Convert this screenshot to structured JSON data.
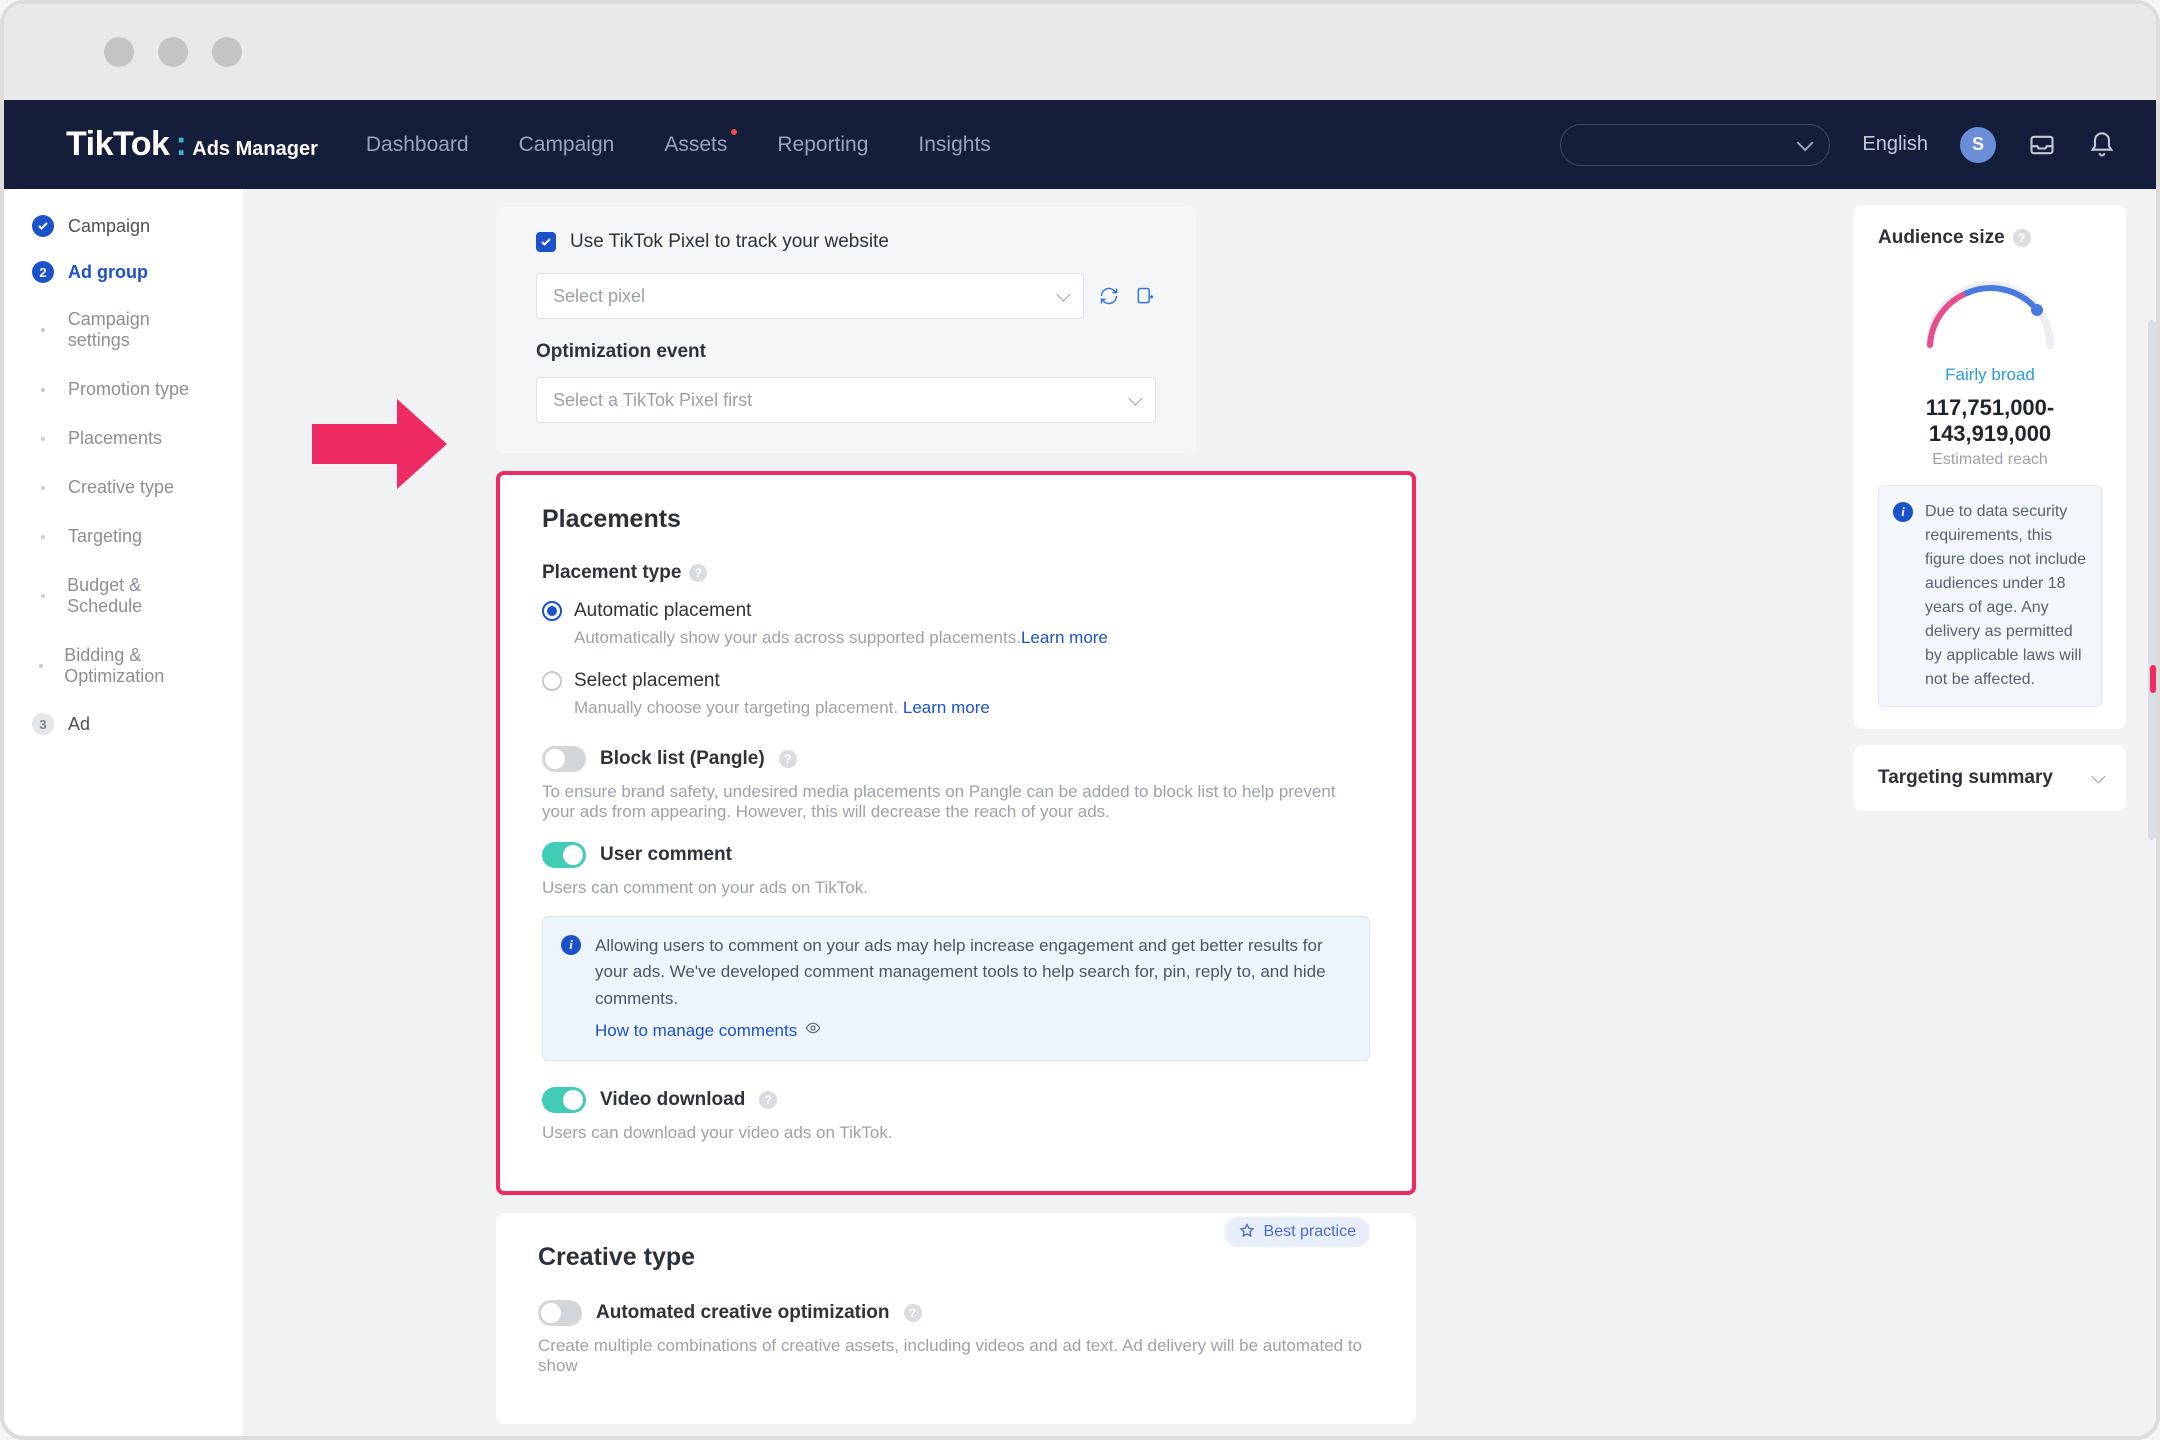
{
  "brand": {
    "name": "TikTok",
    "sep": ":",
    "sub": "Ads Manager"
  },
  "nav": [
    "Dashboard",
    "Campaign",
    "Assets",
    "Reporting",
    "Insights"
  ],
  "lang": "English",
  "avatar_letter": "S",
  "sidebar": {
    "steps": [
      {
        "label": "Campaign",
        "state": "done"
      },
      {
        "label": "Ad group",
        "state": "active",
        "num": "2"
      },
      {
        "label": "Ad",
        "state": "pending",
        "num": "3"
      }
    ],
    "subs": [
      "Campaign settings",
      "Promotion type",
      "Placements",
      "Creative type",
      "Targeting",
      "Budget & Schedule",
      "Bidding & Optimization"
    ]
  },
  "tracking": {
    "checkbox_label": "Use TikTok Pixel to track your website",
    "select_pixel_ph": "Select pixel",
    "opt_label": "Optimization event",
    "opt_ph": "Select a TikTok Pixel first"
  },
  "placements": {
    "title": "Placements",
    "type_label": "Placement type",
    "auto": {
      "label": "Automatic placement",
      "help": "Automatically show your ads across supported placements.",
      "link": "Learn more"
    },
    "select": {
      "label": "Select placement",
      "help": "Manually choose your targeting placement.",
      "link": "Learn more"
    },
    "block": {
      "label": "Block list (Pangle)",
      "desc": "To ensure brand safety, undesired media placements on Pangle can be added to block list to help prevent your ads from appearing. However, this will decrease the reach of your ads."
    },
    "comment": {
      "label": "User comment",
      "desc": "Users can comment on your ads on TikTok.",
      "info": "Allowing users to comment on your ads may help increase engagement and get better results for your ads. We've developed comment management tools to help search for, pin, reply to, and hide comments.",
      "link": "How to manage comments"
    },
    "video": {
      "label": "Video download",
      "desc": "Users can download your video ads on TikTok."
    }
  },
  "creative": {
    "title": "Creative type",
    "badge": "Best practice",
    "auto_label": "Automated creative optimization",
    "auto_desc": "Create multiple combinations of creative assets, including videos and ad text. Ad delivery will be automated to show"
  },
  "rhs": {
    "audience_title": "Audience size",
    "gauge_label": "Fairly broad",
    "reach": "117,751,000-143,919,000",
    "reach_sub": "Estimated reach",
    "note": "Due to data security requirements, this figure does not include audiences under 18 years of age. Any delivery as permitted by applicable laws will not be affected.",
    "targeting_title": "Targeting summary"
  }
}
